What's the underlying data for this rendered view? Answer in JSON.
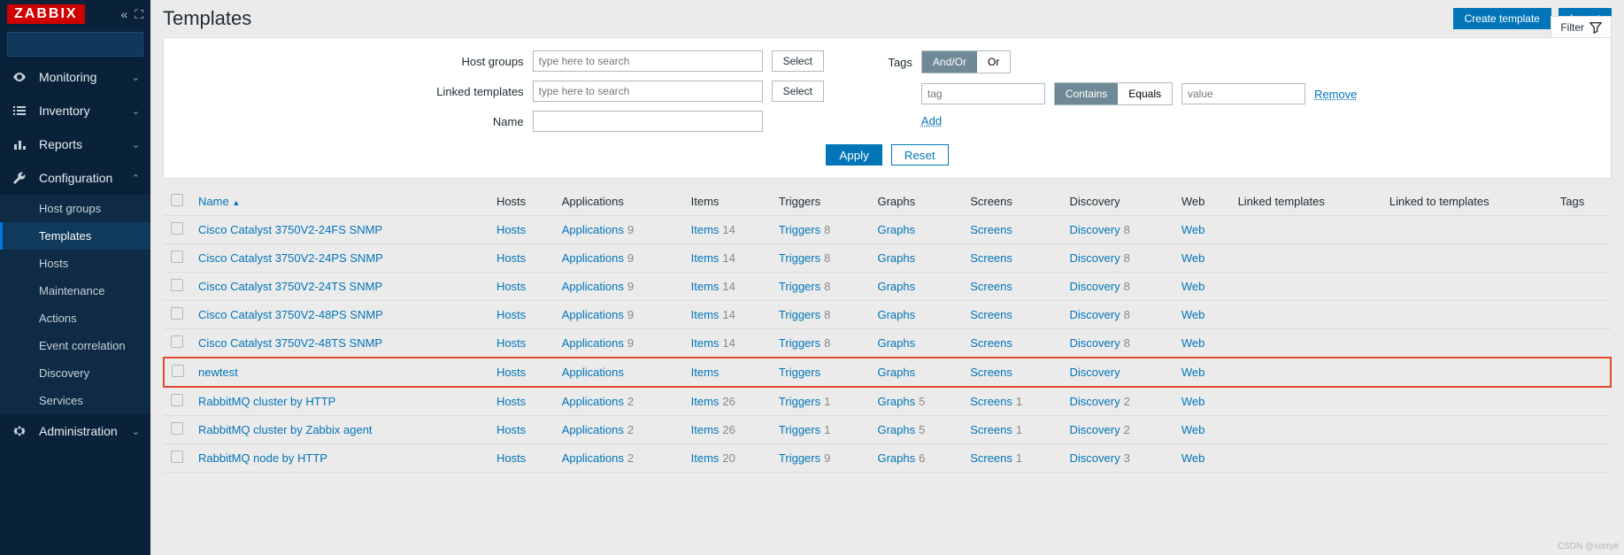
{
  "brand": "ZABBIX",
  "page": {
    "title": "Templates"
  },
  "header_buttons": {
    "create": "Create template",
    "import": "Import"
  },
  "filter_tab": "Filter",
  "sidebar": {
    "sections": [
      {
        "icon": "eye-icon",
        "label": "Monitoring",
        "expanded": false
      },
      {
        "icon": "list-icon",
        "label": "Inventory",
        "expanded": false
      },
      {
        "icon": "chart-icon",
        "label": "Reports",
        "expanded": false
      },
      {
        "icon": "wrench-icon",
        "label": "Configuration",
        "expanded": true,
        "children": [
          "Host groups",
          "Templates",
          "Hosts",
          "Maintenance",
          "Actions",
          "Event correlation",
          "Discovery",
          "Services"
        ],
        "active_child": 1
      },
      {
        "icon": "gear-icon",
        "label": "Administration",
        "expanded": false
      }
    ]
  },
  "filter": {
    "host_groups_label": "Host groups",
    "linked_templates_label": "Linked templates",
    "name_label": "Name",
    "search_placeholder": "type here to search",
    "select_btn": "Select",
    "tags_label": "Tags",
    "andor_options": [
      "And/Or",
      "Or"
    ],
    "andor_active": 0,
    "tag_placeholder": "tag",
    "contains_options": [
      "Contains",
      "Equals"
    ],
    "contains_active": 0,
    "value_placeholder": "value",
    "remove_link": "Remove",
    "add_link": "Add",
    "apply_btn": "Apply",
    "reset_btn": "Reset"
  },
  "table": {
    "columns": [
      "Name",
      "Hosts",
      "Applications",
      "Items",
      "Triggers",
      "Graphs",
      "Screens",
      "Discovery",
      "Web",
      "Linked templates",
      "Linked to templates",
      "Tags"
    ],
    "rows": [
      {
        "name": "Cisco Catalyst 3750V2-24FS SNMP",
        "hosts": "Hosts",
        "apps": "Applications",
        "apps_n": 9,
        "items": "Items",
        "items_n": 14,
        "trig": "Triggers",
        "trig_n": 8,
        "graphs": "Graphs",
        "graphs_n": null,
        "screens": "Screens",
        "screens_n": null,
        "disc": "Discovery",
        "disc_n": 8,
        "web": "Web",
        "hi": false
      },
      {
        "name": "Cisco Catalyst 3750V2-24PS SNMP",
        "hosts": "Hosts",
        "apps": "Applications",
        "apps_n": 9,
        "items": "Items",
        "items_n": 14,
        "trig": "Triggers",
        "trig_n": 8,
        "graphs": "Graphs",
        "graphs_n": null,
        "screens": "Screens",
        "screens_n": null,
        "disc": "Discovery",
        "disc_n": 8,
        "web": "Web",
        "hi": false
      },
      {
        "name": "Cisco Catalyst 3750V2-24TS SNMP",
        "hosts": "Hosts",
        "apps": "Applications",
        "apps_n": 9,
        "items": "Items",
        "items_n": 14,
        "trig": "Triggers",
        "trig_n": 8,
        "graphs": "Graphs",
        "graphs_n": null,
        "screens": "Screens",
        "screens_n": null,
        "disc": "Discovery",
        "disc_n": 8,
        "web": "Web",
        "hi": false
      },
      {
        "name": "Cisco Catalyst 3750V2-48PS SNMP",
        "hosts": "Hosts",
        "apps": "Applications",
        "apps_n": 9,
        "items": "Items",
        "items_n": 14,
        "trig": "Triggers",
        "trig_n": 8,
        "graphs": "Graphs",
        "graphs_n": null,
        "screens": "Screens",
        "screens_n": null,
        "disc": "Discovery",
        "disc_n": 8,
        "web": "Web",
        "hi": false
      },
      {
        "name": "Cisco Catalyst 3750V2-48TS SNMP",
        "hosts": "Hosts",
        "apps": "Applications",
        "apps_n": 9,
        "items": "Items",
        "items_n": 14,
        "trig": "Triggers",
        "trig_n": 8,
        "graphs": "Graphs",
        "graphs_n": null,
        "screens": "Screens",
        "screens_n": null,
        "disc": "Discovery",
        "disc_n": 8,
        "web": "Web",
        "hi": false
      },
      {
        "name": "newtest",
        "hosts": "Hosts",
        "apps": "Applications",
        "apps_n": null,
        "items": "Items",
        "items_n": null,
        "trig": "Triggers",
        "trig_n": null,
        "graphs": "Graphs",
        "graphs_n": null,
        "screens": "Screens",
        "screens_n": null,
        "disc": "Discovery",
        "disc_n": null,
        "web": "Web",
        "hi": true
      },
      {
        "name": "RabbitMQ cluster by HTTP",
        "hosts": "Hosts",
        "apps": "Applications",
        "apps_n": 2,
        "items": "Items",
        "items_n": 26,
        "trig": "Triggers",
        "trig_n": 1,
        "graphs": "Graphs",
        "graphs_n": 5,
        "screens": "Screens",
        "screens_n": 1,
        "disc": "Discovery",
        "disc_n": 2,
        "web": "Web",
        "hi": false
      },
      {
        "name": "RabbitMQ cluster by Zabbix agent",
        "hosts": "Hosts",
        "apps": "Applications",
        "apps_n": 2,
        "items": "Items",
        "items_n": 26,
        "trig": "Triggers",
        "trig_n": 1,
        "graphs": "Graphs",
        "graphs_n": 5,
        "screens": "Screens",
        "screens_n": 1,
        "disc": "Discovery",
        "disc_n": 2,
        "web": "Web",
        "hi": false
      },
      {
        "name": "RabbitMQ node by HTTP",
        "hosts": "Hosts",
        "apps": "Applications",
        "apps_n": 2,
        "items": "Items",
        "items_n": 20,
        "trig": "Triggers",
        "trig_n": 9,
        "graphs": "Graphs",
        "graphs_n": 6,
        "screens": "Screens",
        "screens_n": 1,
        "disc": "Discovery",
        "disc_n": 3,
        "web": "Web",
        "hi": false
      }
    ]
  },
  "watermark": "CSDN @sorry#"
}
